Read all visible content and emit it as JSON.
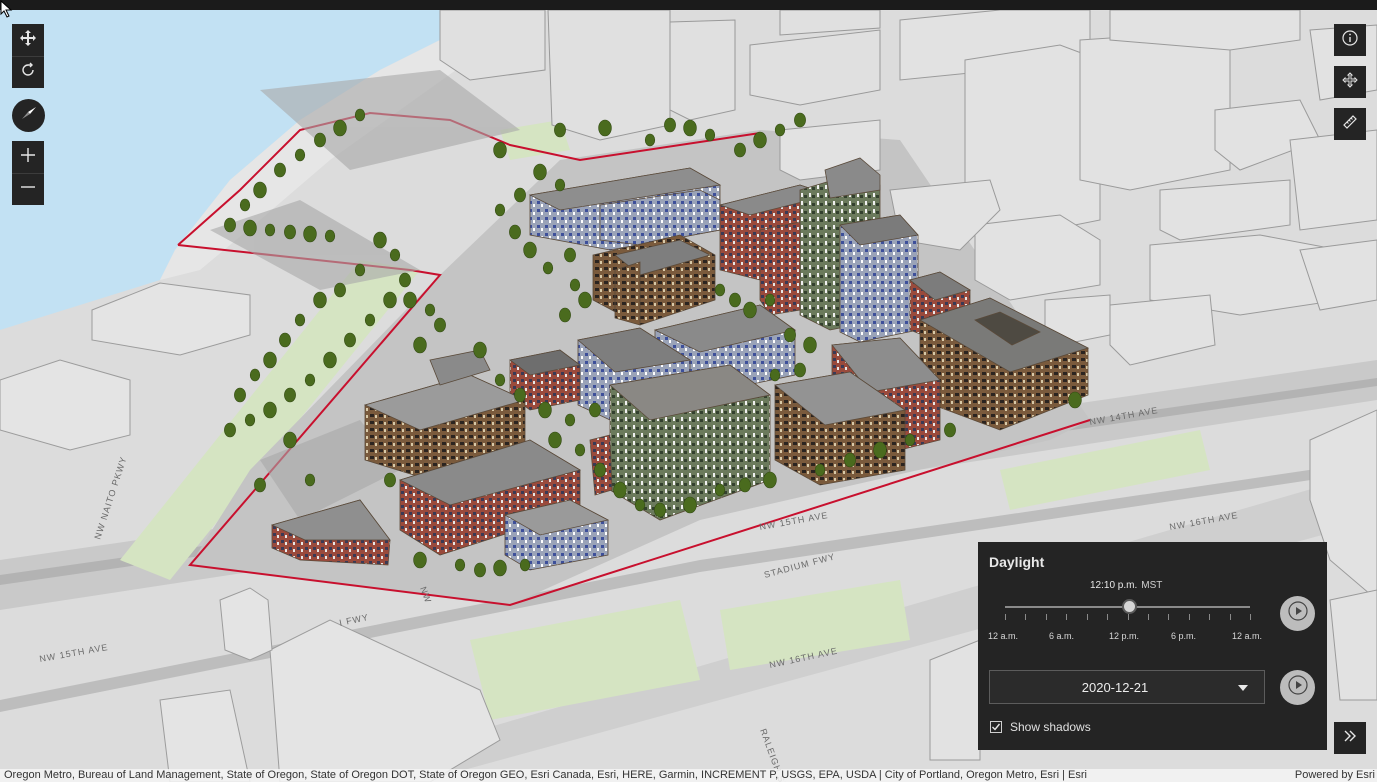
{
  "navigation": {
    "pan_icon": "move-arrows-icon",
    "rotate_icon": "rotate-icon",
    "compass_icon": "compass-icon",
    "zoom_in_icon": "plus-icon",
    "zoom_out_icon": "minus-icon"
  },
  "right_tools": {
    "info_icon": "info-icon",
    "navigation_mode_icon": "hand-move-icon",
    "measure_icon": "ruler-icon"
  },
  "daylight": {
    "title": "Daylight",
    "time_label": "12:10 p.m.",
    "timezone": "MST",
    "time_fraction": 0.507,
    "tick_labels": [
      "12 a.m.",
      "6 a.m.",
      "12 p.m.",
      "6 p.m.",
      "12 a.m."
    ],
    "date_value": "2020-12-21",
    "show_shadows_label": "Show shadows",
    "show_shadows_checked": true,
    "play_icon": "play-icon",
    "dropdown_icon": "chevron-down-icon"
  },
  "expand_icon": "chevron-double-right-icon",
  "map_labels": {
    "naito": "NW NAITO PKWY",
    "stadium": "STADIUM FWY",
    "nw15_left": "NW 15TH AVE",
    "nw15_center": "NW 15TH AVE",
    "nw14": "NW 14TH AVE",
    "nw16_center": "NW 16TH AVE",
    "nw16_right": "NW 16TH AVE",
    "raleigh": "RALEIGH ST",
    "fwy_left": "I FWY",
    "nw_small": "NW"
  },
  "attribution": {
    "credits": "Oregon Metro, Bureau of Land Management, State of Oregon, State of Oregon DOT, State of Oregon GEO, Esri Canada, Esri, HERE, Garmin, INCREMENT P, USGS, EPA, USDA | City of Portland, Oregon Metro, Esri | Esri",
    "powered_by": "Powered by Esri"
  },
  "colors": {
    "panel_bg": "#242424",
    "water": "#bfe0f2",
    "boundary": "#c8102e",
    "park": "#d8e6c4"
  }
}
